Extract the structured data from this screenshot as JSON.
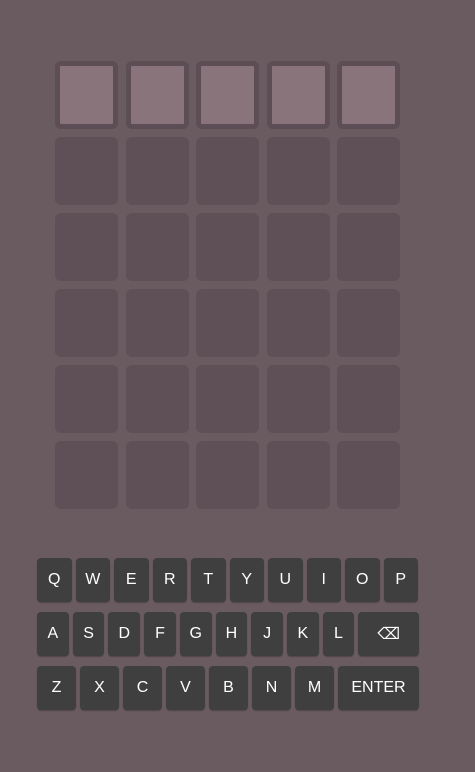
{
  "board": {
    "rows": 6,
    "cols": 5,
    "active_row": 0
  },
  "keyboard": {
    "row1": [
      "Q",
      "W",
      "E",
      "R",
      "T",
      "Y",
      "U",
      "I",
      "O",
      "P"
    ],
    "row2": [
      "A",
      "S",
      "D",
      "F",
      "G",
      "H",
      "J",
      "K",
      "L"
    ],
    "backspace": "⌫",
    "row3": [
      "Z",
      "X",
      "C",
      "V",
      "B",
      "N",
      "M"
    ],
    "enter": "ENTER"
  },
  "colors": {
    "background": "#6a5b61",
    "tile_empty": "#5f4f56",
    "tile_active": "#8a747c",
    "key": "#3f3f3f"
  }
}
